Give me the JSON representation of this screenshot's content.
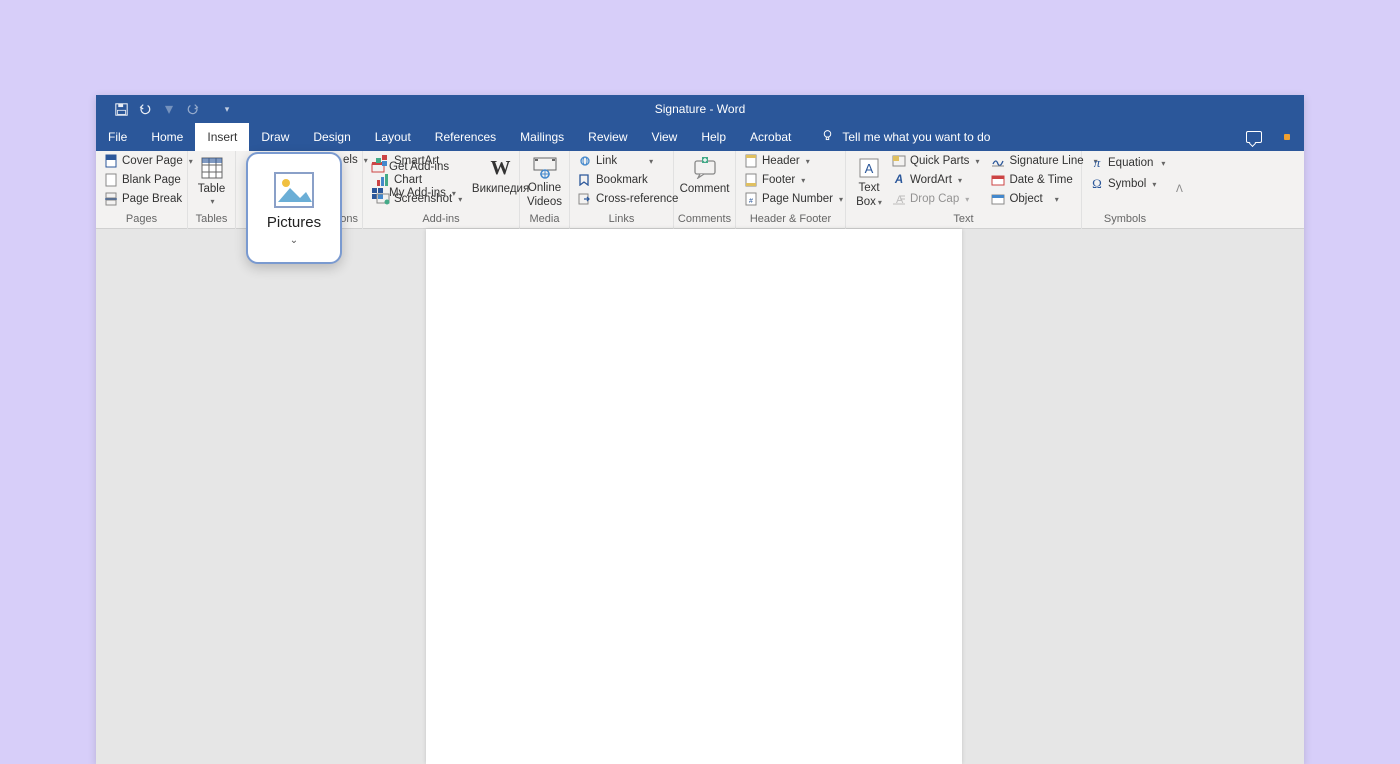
{
  "title": "Signature - Word",
  "tabs": [
    "File",
    "Home",
    "Insert",
    "Draw",
    "Design",
    "Layout",
    "References",
    "Mailings",
    "Review",
    "View",
    "Help",
    "Acrobat"
  ],
  "active_tab": "Insert",
  "tellme": "Tell me what you want to do",
  "groups": {
    "pages": {
      "label": "Pages",
      "cover": "Cover Page",
      "blank": "Blank Page",
      "break": "Page Break"
    },
    "tables": {
      "label": "Tables",
      "table": "Table"
    },
    "illustrations": {
      "label": "strations",
      "els": "els",
      "smartart": "SmartArt",
      "chart": "Chart",
      "screenshot": "Screenshot"
    },
    "addins": {
      "label": "Add-ins",
      "get": "Get Add-ins",
      "my": "My Add-ins",
      "wiki": "Википедия"
    },
    "media": {
      "label": "Media",
      "online_l1": "Online",
      "online_l2": "Videos"
    },
    "links": {
      "label": "Links",
      "link": "Link",
      "bookmark": "Bookmark",
      "crossref": "Cross-reference"
    },
    "comments": {
      "label": "Comments",
      "comment": "Comment"
    },
    "headerfooter": {
      "label": "Header & Footer",
      "header": "Header",
      "footer": "Footer",
      "pagenum": "Page Number"
    },
    "text": {
      "label": "Text",
      "textbox_l1": "Text",
      "textbox_l2": "Box",
      "quickparts": "Quick Parts",
      "wordart": "WordArt",
      "dropcap": "Drop Cap",
      "sigline": "Signature Line",
      "datetime": "Date & Time",
      "object": "Object"
    },
    "symbols": {
      "label": "Symbols",
      "equation": "Equation",
      "symbol": "Symbol"
    }
  },
  "callout": "Pictures"
}
